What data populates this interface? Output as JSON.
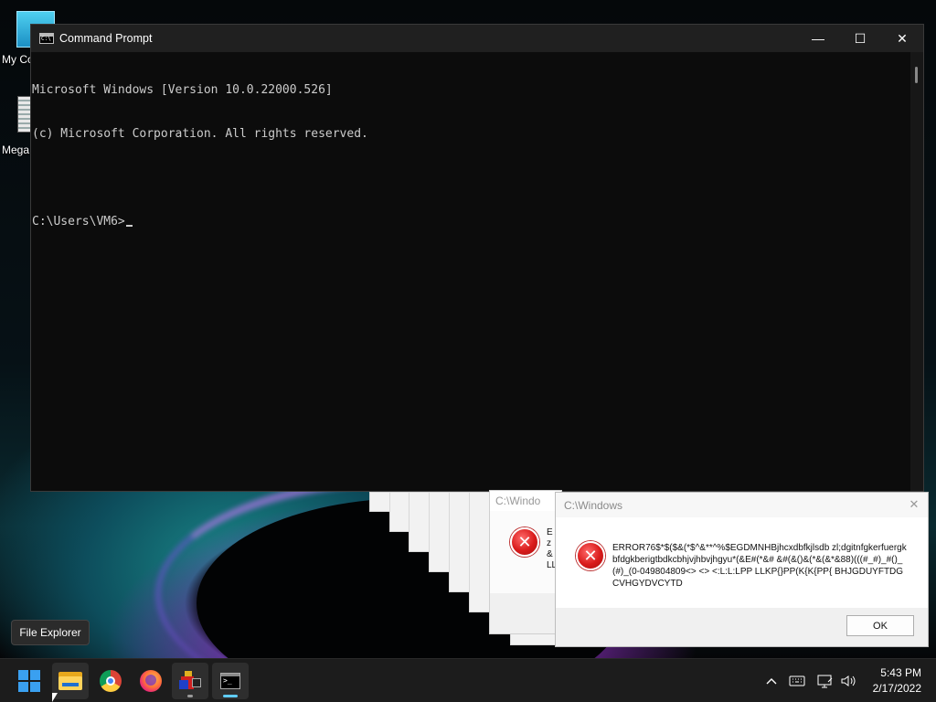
{
  "desktop": {
    "icons": [
      {
        "label": "My Co",
        "icon": "monitor-icon"
      },
      {
        "label": "Mega",
        "icon": "document-icon"
      }
    ]
  },
  "cmd": {
    "title": "Command Prompt",
    "lines": [
      "Microsoft Windows [Version 10.0.22000.526]",
      "(c) Microsoft Corporation. All rights reserved.",
      "",
      "C:\\Users\\VM6>"
    ],
    "buttons": {
      "minimize": "—",
      "maximize": "☐",
      "close": "✕"
    }
  },
  "ghost_dialog": {
    "title": "C:\\Windo",
    "text": "E\nz\n&\nLL"
  },
  "error_dialog": {
    "title": "C:\\Windows",
    "close": "✕",
    "message": "ERROR76$*$($&(*$^&**^%$EGDMNHBjhcxdbfkjlsdb zl;dgitnfgkerfuergkbfdgkberigtbdkcbhjvjhbvjhgyu*(&E#(*&# &#(&()&(*&(&*&88)(((#_#)_#()_(#)_(0-049804809<> <> <:L:L:LPP LLKP{}PP(K{K{PP{ BHJGDUYFTDGCVHGYDVCYTD",
    "ok_label": "OK",
    "icon": "error-icon",
    "accent": "#d91b1b"
  },
  "tooltip": {
    "text": "File Explorer"
  },
  "taskbar": {
    "apps": [
      {
        "name": "start",
        "icon": "windows-start-icon"
      },
      {
        "name": "file-explorer",
        "icon": "folder-icon"
      },
      {
        "name": "chrome",
        "icon": "chrome-icon"
      },
      {
        "name": "firefox",
        "icon": "firefox-icon"
      },
      {
        "name": "app",
        "icon": "app-icon"
      },
      {
        "name": "command-prompt",
        "icon": "terminal-icon"
      }
    ],
    "tray": {
      "chevron": "^",
      "time": "5:43 PM",
      "date": "2/17/2022"
    }
  }
}
